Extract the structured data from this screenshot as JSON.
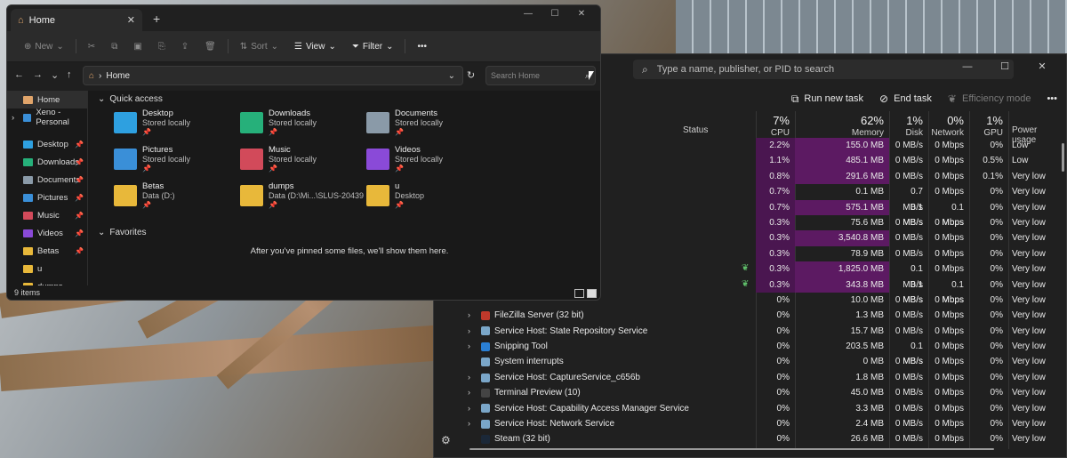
{
  "explorer": {
    "tab_title": "Home",
    "toolbar": {
      "new": "New",
      "sort": "Sort",
      "view": "View",
      "filter": "Filter"
    },
    "address": {
      "location": "Home"
    },
    "search_placeholder": "Search Home",
    "nav": [
      {
        "label": "Home",
        "icon": "home-icon"
      },
      {
        "label": "Xeno - Personal",
        "icon": "onedrive-icon"
      },
      {
        "label": "Desktop",
        "icon": "desktop-folder-icon"
      },
      {
        "label": "Downloads",
        "icon": "downloads-folder-icon"
      },
      {
        "label": "Documents",
        "icon": "documents-folder-icon"
      },
      {
        "label": "Pictures",
        "icon": "pictures-folder-icon"
      },
      {
        "label": "Music",
        "icon": "music-folder-icon"
      },
      {
        "label": "Videos",
        "icon": "videos-folder-icon"
      },
      {
        "label": "Betas",
        "icon": "folder-icon"
      },
      {
        "label": "u",
        "icon": "folder-icon"
      },
      {
        "label": "dumps",
        "icon": "folder-icon"
      }
    ],
    "quick_access_label": "Quick access",
    "quick_access": [
      {
        "name": "Desktop",
        "sub": "Stored locally",
        "color": "#2ea0e0"
      },
      {
        "name": "Downloads",
        "sub": "Stored locally",
        "color": "#26b07a"
      },
      {
        "name": "Documents",
        "sub": "Stored locally",
        "color": "#8a9aa8"
      },
      {
        "name": "Pictures",
        "sub": "Stored locally",
        "color": "#3a8fd8"
      },
      {
        "name": "Music",
        "sub": "Stored locally",
        "color": "#d24a5a"
      },
      {
        "name": "Videos",
        "sub": "Stored locally",
        "color": "#8a4ad8"
      },
      {
        "name": "Betas",
        "sub": "Data (D:)",
        "color": "#e8b83a"
      },
      {
        "name": "dumps",
        "sub": "Data (D:\\Mi...\\SLUS-20439",
        "color": "#e8b83a"
      },
      {
        "name": "u",
        "sub": "Desktop",
        "color": "#e8b83a"
      }
    ],
    "favorites_label": "Favorites",
    "favorites_empty": "After you've pinned some files, we'll show them here.",
    "status": "9 items"
  },
  "taskmanager": {
    "search_placeholder": "Type a name, publisher, or PID to search",
    "commands": {
      "run_new_task": "Run new task",
      "end_task": "End task",
      "efficiency_mode": "Efficiency mode"
    },
    "columns": {
      "status": "Status",
      "cpu": {
        "pct": "7%",
        "label": "CPU"
      },
      "memory": {
        "pct": "62%",
        "label": "Memory"
      },
      "disk": {
        "pct": "1%",
        "label": "Disk"
      },
      "network": {
        "pct": "0%",
        "label": "Network"
      },
      "gpu": {
        "pct": "1%",
        "label": "GPU"
      },
      "power": "Power usage"
    },
    "rows": [
      {
        "name": "",
        "cpu": "2.2%",
        "mem": "155.0 MB",
        "disk": "0 MB/s",
        "net": "0 Mbps",
        "gpu": "0%",
        "power": "Low"
      },
      {
        "name": "",
        "cpu": "1.1%",
        "mem": "485.1 MB",
        "disk": "0 MB/s",
        "net": "0 Mbps",
        "gpu": "0.5%",
        "power": "Low"
      },
      {
        "name": "",
        "cpu": "0.8%",
        "mem": "291.6 MB",
        "disk": "0 MB/s",
        "net": "0 Mbps",
        "gpu": "0.1%",
        "power": "Very low"
      },
      {
        "name": "",
        "cpu": "0.7%",
        "mem": "0.1 MB",
        "disk": "0.7 MB/s",
        "net": "0 Mbps",
        "gpu": "0%",
        "power": "Very low"
      },
      {
        "name": "",
        "cpu": "0.7%",
        "mem": "575.1 MB",
        "disk": "0.1 MB/s",
        "net": "0.1 Mbps",
        "gpu": "0%",
        "power": "Very low"
      },
      {
        "name": "tive Message Host (2)",
        "cpu": "0.3%",
        "mem": "75.6 MB",
        "disk": "0 MB/s",
        "net": "0 Mbps",
        "gpu": "0%",
        "power": "Very low"
      },
      {
        "name": "",
        "cpu": "0.3%",
        "mem": "3,540.8 MB",
        "disk": "0 MB/s",
        "net": "0 Mbps",
        "gpu": "0%",
        "power": "Very low"
      },
      {
        "name": "",
        "cpu": "0.3%",
        "mem": "78.9 MB",
        "disk": "0 MB/s",
        "net": "0 Mbps",
        "gpu": "0%",
        "power": "Very low"
      },
      {
        "name": "",
        "cpu": "0.3%",
        "mem": "1,825.0 MB",
        "disk": "0.1 MB/s",
        "net": "0 Mbps",
        "gpu": "0%",
        "power": "Very low",
        "leaf": true
      },
      {
        "name": "",
        "cpu": "0.3%",
        "mem": "343.8 MB",
        "disk": "0.1 MB/s",
        "net": "0.1 Mbps",
        "gpu": "0%",
        "power": "Very low",
        "leaf": true
      },
      {
        "name": "",
        "cpu": "0%",
        "mem": "10.0 MB",
        "disk": "0 MB/s",
        "net": "0 Mbps",
        "gpu": "0%",
        "power": "Very low"
      },
      {
        "name": "FileZilla Server (32 bit)",
        "cpu": "0%",
        "mem": "1.3 MB",
        "disk": "0 MB/s",
        "net": "0 Mbps",
        "gpu": "0%",
        "power": "Very low",
        "expand": true,
        "color": "#c0392b"
      },
      {
        "name": "Service Host: State Repository Service",
        "cpu": "0%",
        "mem": "15.7 MB",
        "disk": "0 MB/s",
        "net": "0 Mbps",
        "gpu": "0%",
        "power": "Very low",
        "expand": true,
        "color": "#7aa6c8"
      },
      {
        "name": "Snipping Tool",
        "cpu": "0%",
        "mem": "203.5 MB",
        "disk": "0.1 MB/s",
        "net": "0 Mbps",
        "gpu": "0%",
        "power": "Very low",
        "expand": true,
        "color": "#2a7fd4"
      },
      {
        "name": "System interrupts",
        "cpu": "0%",
        "mem": "0 MB",
        "disk": "0 MB/s",
        "net": "0 Mbps",
        "gpu": "0%",
        "power": "Very low",
        "expand": false,
        "color": "#7aa6c8"
      },
      {
        "name": "Service Host: CaptureService_c656b",
        "cpu": "0%",
        "mem": "1.8 MB",
        "disk": "0 MB/s",
        "net": "0 Mbps",
        "gpu": "0%",
        "power": "Very low",
        "expand": true,
        "color": "#7aa6c8"
      },
      {
        "name": "Terminal Preview (10)",
        "cpu": "0%",
        "mem": "45.0 MB",
        "disk": "0 MB/s",
        "net": "0 Mbps",
        "gpu": "0%",
        "power": "Very low",
        "expand": true,
        "color": "#444"
      },
      {
        "name": "Service Host: Capability Access Manager Service",
        "cpu": "0%",
        "mem": "3.3 MB",
        "disk": "0 MB/s",
        "net": "0 Mbps",
        "gpu": "0%",
        "power": "Very low",
        "expand": true,
        "color": "#7aa6c8"
      },
      {
        "name": "Service Host: Network Service",
        "cpu": "0%",
        "mem": "2.4 MB",
        "disk": "0 MB/s",
        "net": "0 Mbps",
        "gpu": "0%",
        "power": "Very low",
        "expand": true,
        "color": "#7aa6c8"
      },
      {
        "name": "Steam (32 bit)",
        "cpu": "0%",
        "mem": "26.6 MB",
        "disk": "0 MB/s",
        "net": "0 Mbps",
        "gpu": "0%",
        "power": "Very low",
        "expand": false,
        "color": "#1b2838"
      }
    ]
  }
}
